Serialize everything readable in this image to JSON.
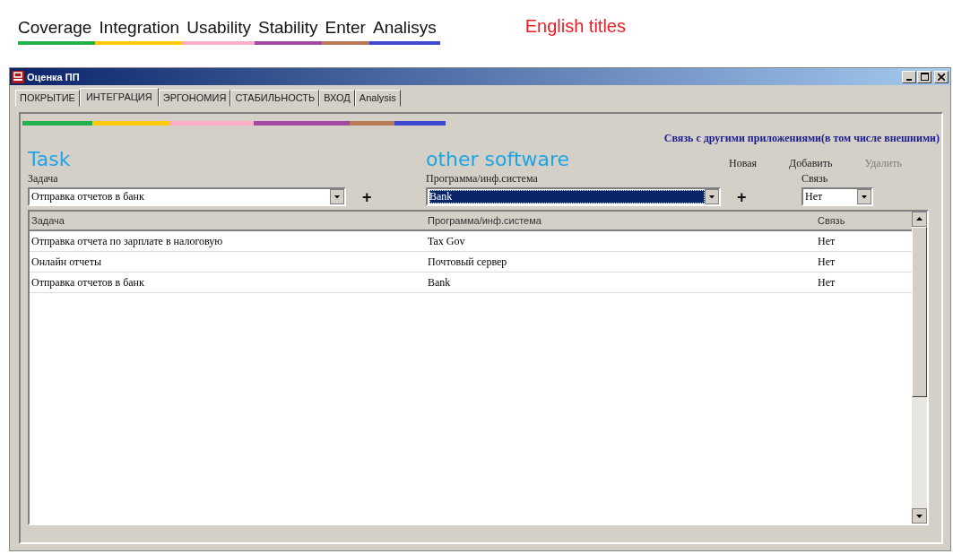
{
  "annotations": {
    "legend": [
      {
        "label": "Coverage",
        "color": "#22b14c"
      },
      {
        "label": "Integration",
        "color": "#ffc90e"
      },
      {
        "label": "Usability",
        "color": "#ffaec9"
      },
      {
        "label": "Stability",
        "color": "#a349a4"
      },
      {
        "label": "Enter",
        "color": "#b97a57"
      },
      {
        "label": "Analisys",
        "color": "#3f48cc"
      }
    ],
    "note": "English titles",
    "field_notes": [
      "Task",
      "other software"
    ]
  },
  "window": {
    "title": "Оценка ПП",
    "tabs": [
      {
        "label": "ПОКРЫТИЕ",
        "selected": false,
        "color": "#22b14c"
      },
      {
        "label": "ИНТЕГРАЦИЯ",
        "selected": true,
        "color": "#ffc90e"
      },
      {
        "label": "ЭРГОНОМИЯ",
        "selected": false,
        "color": "#ffaec9"
      },
      {
        "label": "СТАБИЛЬНОСТЬ",
        "selected": false,
        "color": "#a349a4"
      },
      {
        "label": "ВХОД",
        "selected": false,
        "color": "#b97a57"
      },
      {
        "label": "Analysis",
        "selected": false,
        "color": "#3f48cc"
      }
    ],
    "header": "Связь с другими приложениями(в том числе внешними)",
    "buttons": [
      {
        "label": "Новая",
        "disabled": false
      },
      {
        "label": "Добавить",
        "disabled": false
      },
      {
        "label": "Удалить",
        "disabled": true
      }
    ],
    "fields": [
      {
        "label": "Задача",
        "value": "Отправка отчетов в банк",
        "selected": false,
        "add": "+"
      },
      {
        "label": "Программа/инф.система",
        "value": "Bank",
        "selected": true,
        "add": "+"
      },
      {
        "label": "Связь",
        "value": "Нет",
        "selected": false
      }
    ],
    "table": {
      "columns": [
        "Задача",
        "Программа/инф.система",
        "Связь"
      ],
      "rows": [
        [
          "Отправка отчета по зарплате в налоговую",
          "Tax Gov",
          "Нет"
        ],
        [
          "Онлайн отчеты",
          "Почтовый сервер",
          "Нет"
        ],
        [
          "Отправка отчетов в банк",
          "Bank",
          "Нет"
        ]
      ]
    }
  }
}
